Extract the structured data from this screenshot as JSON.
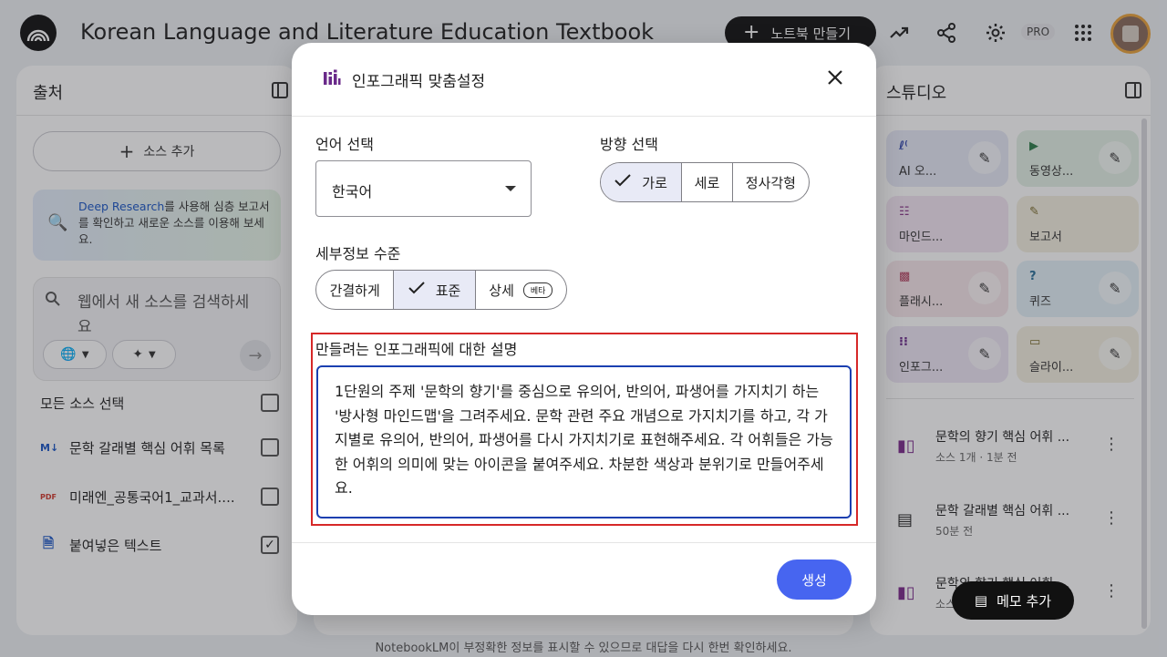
{
  "app": {
    "title": "Korean Language and Literature Education Textbook",
    "new_notebook_label": "노트북 만들기",
    "pro_badge": "PRO",
    "footer_notice": "NotebookLM이 부정확한 정보를 표시할 수 있으므로 대답을 다시 한번 확인하세요."
  },
  "sources_panel": {
    "title": "출처",
    "add_source_label": "소스 추가",
    "deep_research": {
      "highlight": "Deep Research",
      "text": "를 사용해 심층 보고서를 확인하고 새로운 소스를 이용해 보세요."
    },
    "web_search_placeholder": "웹에서 새 소스를 검색하세",
    "web_search_placeholder_line2": "요",
    "select_all_label": "모든 소스 선택",
    "sources": [
      {
        "label": "문학 갈래별 핵심 어휘 목록",
        "icon": "markdown-icon",
        "checked": false
      },
      {
        "label": "미래엔_공통국어1_교과서....",
        "icon": "pdf-icon",
        "checked": false
      },
      {
        "label": "붙여넣은 텍스트",
        "icon": "document-icon",
        "checked": true
      }
    ]
  },
  "studio_panel": {
    "title": "스튜디오",
    "tiles": [
      {
        "label": "AI 오...",
        "icon": "audio-icon",
        "color": "#e6e9f7"
      },
      {
        "label": "동영상...",
        "icon": "video-icon",
        "color": "#e4f1e6"
      },
      {
        "label": "마인드...",
        "icon": "mindmap-icon",
        "color": "#f3e6f3"
      },
      {
        "label": "보고서",
        "icon": "report-icon",
        "color": "#f3efe0"
      },
      {
        "label": "플래시...",
        "icon": "flashcard-icon",
        "color": "#f7e6ea"
      },
      {
        "label": "퀴즈",
        "icon": "quiz-icon",
        "color": "#e3f1f8"
      },
      {
        "label": "인포그...",
        "icon": "infographic-icon",
        "color": "#eee6f5"
      },
      {
        "label": "슬라이...",
        "icon": "slides-icon",
        "color": "#f3efe0"
      }
    ],
    "notes": [
      {
        "title": "문학의 향기 핵심 어휘 ...",
        "subtitle": "소스 1개 · 1분 전",
        "icon": "infographic-icon"
      },
      {
        "title": "문학 갈래별 핵심 어휘 ...",
        "subtitle": "50분 전",
        "icon": "note-icon"
      },
      {
        "title": "문학의 향기 핵심 어휘 ...",
        "subtitle": "소스 1개",
        "icon": "infographic-icon"
      }
    ],
    "memo_add_label": "메모 추가"
  },
  "modal": {
    "title": "인포그래픽 맞춤설정",
    "language_label": "언어 선택",
    "language_value": "한국어",
    "orientation_label": "방향 선택",
    "orientation_options": [
      "가로",
      "세로",
      "정사각형"
    ],
    "orientation_selected": "가로",
    "detail_label": "세부정보 수준",
    "detail_options": [
      "간결하게",
      "표준",
      "상세"
    ],
    "detail_selected": "표준",
    "beta_label": "베타",
    "description_label": "만들려는 인포그래픽에 대한 설명",
    "description_text": "1단원의 주제 '문학의 향기'를 중심으로 유의어, 반의어, 파생어를 가지치기 하는 '방사형 마인드맵'을 그려주세요. 문학 관련 주요 개념으로 가지치기를 하고, 각 가지별로 유의어, 반의어, 파생어를 다시 가지치기로 표현해주세요. 각 어휘들은 가능한 어휘의 의미에 맞는 아이콘을 붙여주세요. 차분한 색상과 분위기로 만들어주세요.",
    "generate_label": "생성"
  },
  "colors": {
    "accent": "#4765f0",
    "highlight_border": "#d62828",
    "textarea_border": "#1a3fb0",
    "selected_segment": "#e8eaf6"
  }
}
